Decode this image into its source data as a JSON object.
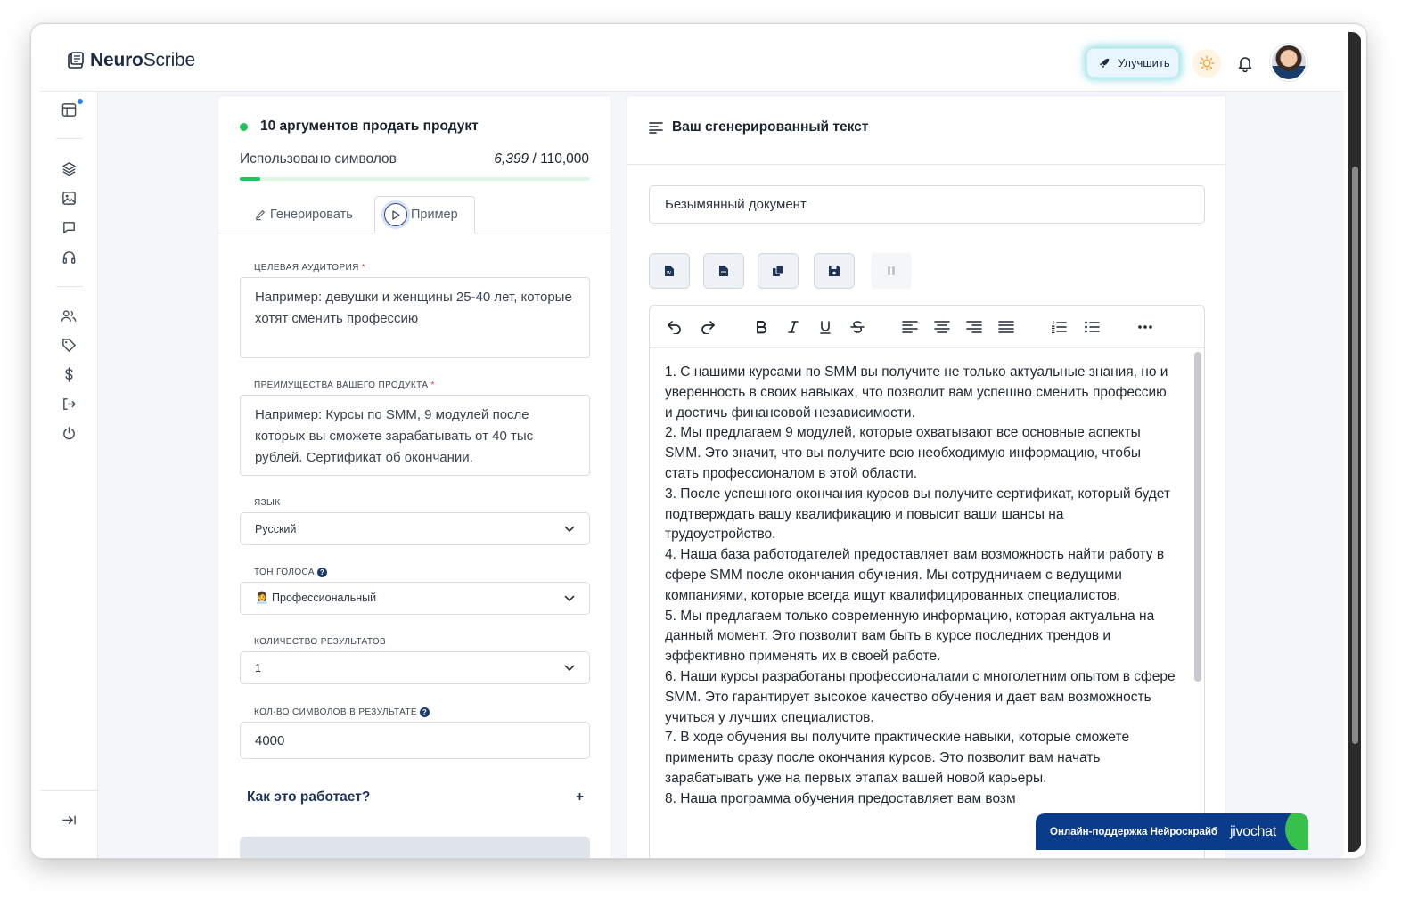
{
  "brand": {
    "name_bold": "Neuro",
    "name_light": "Scribe"
  },
  "header": {
    "upgrade_label": "Улучшить"
  },
  "left_panel": {
    "title": "10 аргументов продать продукт",
    "usage_label": "Использовано символов",
    "usage_used": "6,399",
    "usage_total": "/ 110,000",
    "usage_fraction": 0.058,
    "tabs": [
      {
        "label": "Генерировать"
      },
      {
        "label": "Пример"
      }
    ],
    "fields": {
      "audience": {
        "label": "ЦЕЛЕВАЯ АУДИТОРИЯ",
        "required_mark": "*",
        "value": "Например: девушки и женщины 25-40 лет, которые хотят сменить профессию"
      },
      "advantages": {
        "label": "ПРЕИМУЩЕСТВА ВАШЕГО ПРОДУКТА",
        "required_mark": "*",
        "value": "Например: Курсы по SMM, 9 модулей после которых вы сможете зарабатывать от 40 тыс рублей. Сертификат об окончании."
      },
      "language": {
        "label": "ЯЗЫК",
        "value": "Русский"
      },
      "tone": {
        "label": "ТОН ГОЛОСА",
        "value": "👩‍💼 Профессиональный"
      },
      "results_count": {
        "label": "КОЛИЧЕСТВО РЕЗУЛЬТАТОВ",
        "value": "1"
      },
      "chars": {
        "label": "КОЛ-ВО СИМВОЛОВ В РЕЗУЛЬТАТЕ",
        "value": "4000"
      }
    },
    "help_q": "?",
    "how_it_works": "Как это работает?",
    "how_plus": "+"
  },
  "right_panel": {
    "title": "Ваш сгенерированный текст",
    "doc_name": "Безымянный документ",
    "content": [
      "1. С нашими курсами по SMM вы получите не только актуальные знания, но и уверенность в своих навыках, что позволит вам успешно сменить профессию и достичь финансовой независимости.",
      "2. Мы предлагаем 9 модулей, которые охватывают все основные аспекты SMM. Это значит, что вы получите всю необходимую информацию, чтобы стать профессионалом в этой области.",
      "3. После успешного окончания курсов вы получите сертификат, который будет подтверждать вашу квалификацию и повысит ваши шансы на трудоустройство.",
      "4. Наша база работодателей предоставляет вам возможность найти работу в сфере SMM после окончания обучения. Мы сотрудничаем с ведущими компаниями, которые всегда ищут квалифицированных специалистов.",
      "5. Мы предлагаем только современную информацию, которая актуальна на данный момент. Это позволит вам быть в курсе последних трендов и эффективно применять их в своей работе.",
      "6. Наши курсы разработаны профессионалами с многолетним опытом в сфере SMM. Это гарантирует высокое качество обучения и дает вам возможность учиться у лучших специалистов.",
      "7. В ходе обучения вы получите практические навыки, которые сможете применить сразу после окончания курсов. Это позволит вам начать зарабатывать уже на первых этапах вашей новой карьеры.",
      "8. Наша программа обучения предоставляет вам возм"
    ]
  },
  "jivo": {
    "text": "Онлайн-поддержка Нейроскрайб",
    "logo": "jivochat"
  },
  "colors": {
    "accent_green": "#22c35e",
    "navy": "#1e3559",
    "jivo_blue": "#0b3c8c"
  }
}
